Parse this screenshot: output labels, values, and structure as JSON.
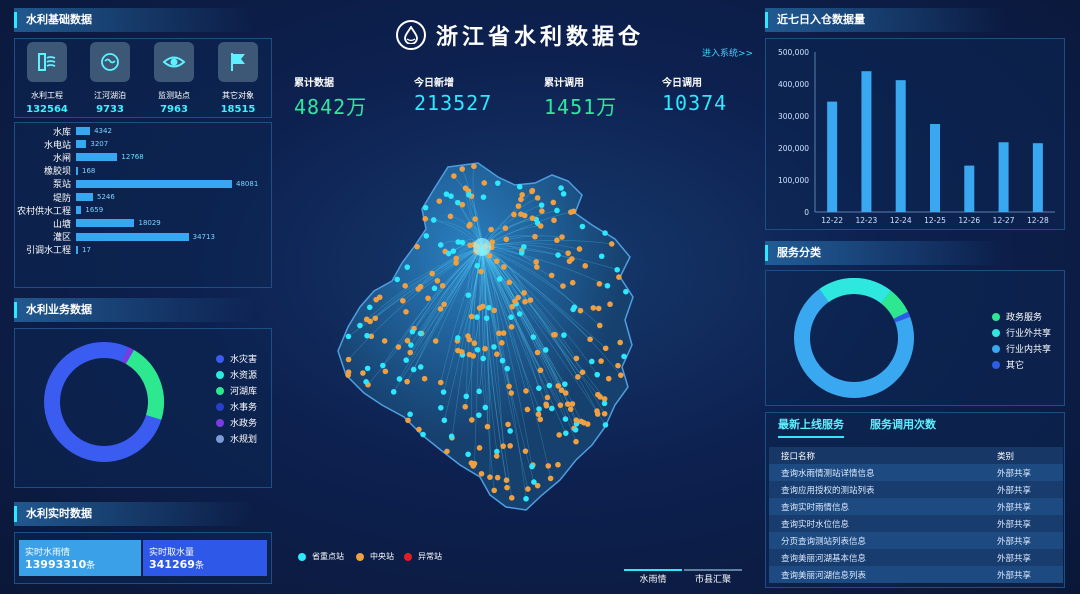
{
  "title": "浙江省水利数据仓",
  "enter_link": "进入系统>>",
  "kpis": [
    {
      "label": "累计数据",
      "value": "4842万",
      "color": "#2ee8a0"
    },
    {
      "label": "今日新增",
      "value": "213527",
      "color": "#2ee8ff"
    },
    {
      "label": "累计调用",
      "value": "1451万",
      "color": "#2ee8a0"
    },
    {
      "label": "今日调用",
      "value": "10374",
      "color": "#2ee8ff"
    }
  ],
  "basic": {
    "title": "水利基础数据",
    "icons": [
      {
        "name": "水利工程",
        "value": "132564",
        "icon": "dam-icon"
      },
      {
        "name": "江河湖泊",
        "value": "9733",
        "icon": "river-icon"
      },
      {
        "name": "监测站点",
        "value": "7963",
        "icon": "eye-icon"
      },
      {
        "name": "其它对象",
        "value": "18515",
        "icon": "flag-icon"
      }
    ],
    "bars": [
      {
        "label": "水库",
        "value": 4342
      },
      {
        "label": "水电站",
        "value": 3207
      },
      {
        "label": "水闸",
        "value": 12768
      },
      {
        "label": "橡胶坝",
        "value": 168
      },
      {
        "label": "泵站",
        "value": 48081
      },
      {
        "label": "堤防",
        "value": 5246
      },
      {
        "label": "农村供水工程",
        "value": 1659
      },
      {
        "label": "山塘",
        "value": 18029
      },
      {
        "label": "灌区",
        "value": 34713
      },
      {
        "label": "引调水工程",
        "value": 17
      }
    ]
  },
  "business": {
    "title": "水利业务数据",
    "legend": [
      {
        "label": "水灾害",
        "color": "#3a5cf0"
      },
      {
        "label": "水资源",
        "color": "#2ee8e0"
      },
      {
        "label": "河湖库",
        "color": "#2ee890"
      },
      {
        "label": "水事务",
        "color": "#2740c8"
      },
      {
        "label": "水政务",
        "color": "#7a3ce0"
      },
      {
        "label": "水规划",
        "color": "#7a9ad8"
      }
    ]
  },
  "realtime": {
    "title": "水利实时数据",
    "rain_label": "实时水雨情",
    "rain_value": "13993310",
    "rain_unit": "条",
    "intake_label": "实时取水量",
    "intake_value": "341269",
    "intake_unit": "条"
  },
  "map_legend": [
    {
      "label": "省重点站",
      "color": "#2ee8ff"
    },
    {
      "label": "中央站",
      "color": "#f0a040"
    },
    {
      "label": "异常站",
      "color": "#e02020"
    }
  ],
  "bottom_tabs": [
    "水雨情",
    "市县汇聚"
  ],
  "weekly": {
    "title": "近七日入仓数据量",
    "y_ticks": [
      "500,000",
      "400,000",
      "300,000",
      "200,000",
      "100,000",
      "0"
    ]
  },
  "chart_data": {
    "type": "bar",
    "title": "近七日入仓数据量",
    "categories": [
      "12-22",
      "12-23",
      "12-24",
      "12-25",
      "12-26",
      "12-27",
      "12-28"
    ],
    "values": [
      345000,
      440000,
      412000,
      275000,
      145000,
      218000,
      215000
    ],
    "ylim": [
      0,
      500000
    ],
    "grid": false
  },
  "service": {
    "title": "服务分类",
    "legend": [
      {
        "label": "政务服务",
        "color": "#2ee890"
      },
      {
        "label": "行业外共享",
        "color": "#2ee8e0"
      },
      {
        "label": "行业内共享",
        "color": "#3aa8f0"
      },
      {
        "label": "其它",
        "color": "#2c5ce8"
      }
    ]
  },
  "latest": {
    "tabs": [
      "最新上线服务",
      "服务调用次数"
    ],
    "headers": [
      "接口名称",
      "类别"
    ],
    "rows": [
      [
        "查询水雨情测站详情信息",
        "外部共享"
      ],
      [
        "查询应用授权的测站列表",
        "外部共享"
      ],
      [
        "查询实时雨情信息",
        "外部共享"
      ],
      [
        "查询实时水位信息",
        "外部共享"
      ],
      [
        "分页查询测站列表信息",
        "外部共享"
      ],
      [
        "查询美丽河湖基本信息",
        "外部共享"
      ],
      [
        "查询美丽河湖信息列表",
        "外部共享"
      ]
    ]
  }
}
